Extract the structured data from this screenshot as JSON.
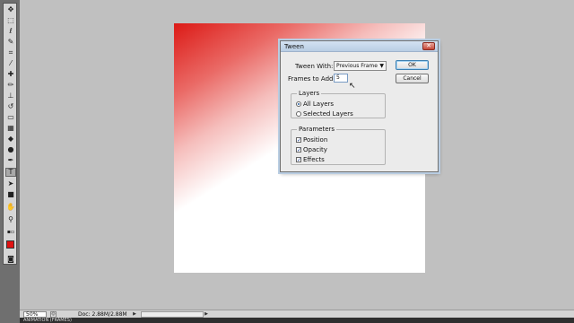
{
  "dialog": {
    "title": "Tween",
    "close_glyph": "✕",
    "tween_with_label": "Tween With:",
    "tween_with_value": "Previous Frame",
    "frames_to_add_label": "Frames to Add:",
    "frames_to_add_value": "5",
    "ok_label": "OK",
    "cancel_label": "Cancel",
    "layers": {
      "title": "Layers",
      "options": [
        {
          "label": "All Layers",
          "checked": true
        },
        {
          "label": "Selected Layers",
          "checked": false
        }
      ]
    },
    "parameters": {
      "title": "Parameters",
      "options": [
        {
          "label": "Position",
          "checked": true
        },
        {
          "label": "Opacity",
          "checked": true
        },
        {
          "label": "Effects",
          "checked": true
        }
      ]
    }
  },
  "statusbar": {
    "zoom": "50%",
    "doc": "Doc: 2.88M/2.88M"
  },
  "bottom_panel": {
    "title": "ANIMATION (FRAMES)"
  },
  "toolbar": {
    "icons": [
      "move-icon",
      "marquee-icon",
      "lasso-icon",
      "quick-select-icon",
      "crop-icon",
      "eyedropper-icon",
      "healing-icon",
      "brush-icon",
      "clone-stamp-icon",
      "history-brush-icon",
      "eraser-icon",
      "gradient-icon",
      "blur-icon",
      "dodge-icon",
      "pen-icon",
      "type-icon",
      "path-select-icon",
      "shape-icon",
      "hand-icon",
      "zoom-icon"
    ],
    "foreground_color": "#e01212",
    "background_color": "#ffffff"
  },
  "canvas": {
    "gradient_start": "#dc1a16",
    "gradient_end": "#ffffff"
  }
}
